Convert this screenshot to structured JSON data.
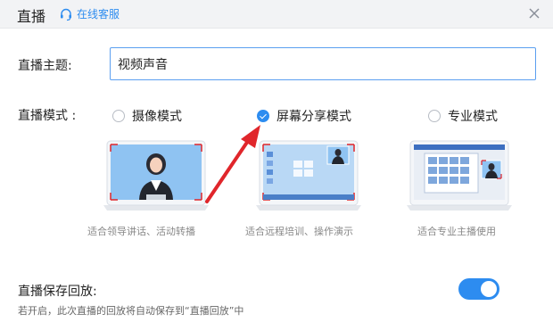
{
  "header": {
    "title": "直播",
    "service_link": "在线客服",
    "icon": "headset-icon",
    "close_icon": "close-icon"
  },
  "form": {
    "topic_label": "直播主题:",
    "topic_value": "视频声音",
    "mode_label": "直播模式 :",
    "modes": [
      {
        "label": "摄像模式",
        "selected": false,
        "caption": "适合领导讲话、活动转播"
      },
      {
        "label": "屏幕分享模式",
        "selected": true,
        "caption": "适合远程培训、操作演示"
      },
      {
        "label": "专业模式",
        "selected": false,
        "caption": "适合专业主播使用"
      }
    ]
  },
  "save": {
    "label": "直播保存回放:",
    "description": "若开启，此次直播的回放将自动保存到“直播回放”中",
    "toggle_on": true
  },
  "colors": {
    "accent": "#2d8cf0",
    "annotation_arrow": "#e0262b",
    "header_bg": "#f2f3f5"
  }
}
